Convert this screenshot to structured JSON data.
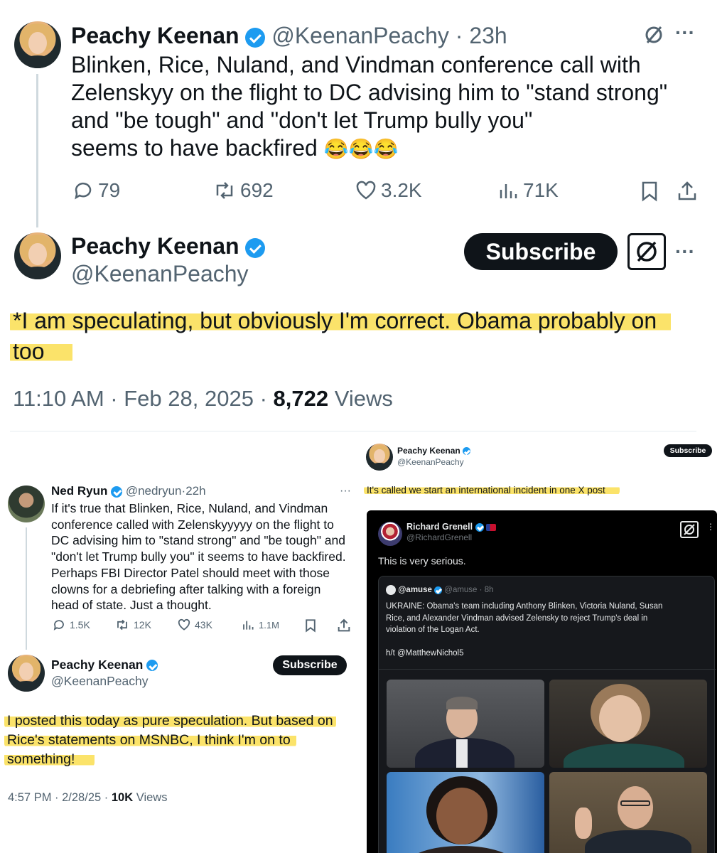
{
  "tweet1": {
    "name": "Peachy Keenan",
    "handle": "@KeenanPeachy",
    "sep": "·",
    "time": "23h",
    "text_line1": "Blinken, Rice, Nuland, and Vindman conference call with",
    "text_line2": "Zelenskyy on the flight to DC advising him to \"stand strong\"",
    "text_line3": "and \"be tough\" and \"don't let Trump bully you\"",
    "text_line4": "seems to have backfired",
    "emoji": "😂😂😂",
    "replies": "79",
    "reposts": "692",
    "likes": "3.2K",
    "views": "71K"
  },
  "tweet2": {
    "name": "Peachy Keenan",
    "handle": "@KeenanPeachy",
    "subscribe": "Subscribe",
    "text_line1": "*I am speculating, but obviously I'm correct. Obama probably on",
    "text_line2": "too",
    "time": "11:10 AM",
    "date": "Feb 28, 2025",
    "views_count": "8,722",
    "views_label": "Views"
  },
  "ned": {
    "name": "Ned Ryun",
    "handle": "@nedryun",
    "time": "22h",
    "lines": [
      "If it's true that Blinken, Rice, Nuland, and Vindman",
      "conference called with Zelenskyyyyy on the flight to",
      "DC advising him to \"stand strong\" and \"be tough\" and",
      "\"don't let Trump bully you\" it seems to have backfired.",
      "Perhaps FBI Director Patel should meet with those",
      "clowns for a debriefing after talking with a foreign",
      "head of state. Just a thought."
    ],
    "replies": "1.5K",
    "reposts": "12K",
    "likes": "43K",
    "views": "1.1M"
  },
  "tweet3": {
    "name": "Peachy Keenan",
    "handle": "@KeenanPeachy",
    "subscribe": "Subscribe",
    "line1": "I posted this today as pure speculation. But based on",
    "line2": "Rice's statements on MSNBC, I think I'm on to",
    "line3": "something!",
    "time": "4:57 PM",
    "date": "2/28/25",
    "views_count": "10K",
    "views_label": "Views"
  },
  "tweet4": {
    "name": "Peachy Keenan",
    "handle": "@KeenanPeachy",
    "subscribe": "Subscribe",
    "text": "It's called we start an international incident in one X post"
  },
  "grenell": {
    "name": "Richard Grenell",
    "handle": "@RichardGrenell",
    "text": "This is very serious.",
    "quote": {
      "name": "@amuse",
      "handle": "@amuse",
      "time": "8h",
      "line1": "UKRAINE: Obama's team including Anthony Blinken, Victoria Nuland, Susan",
      "line2": "Rice, and Alexander Vindman advised Zelensky to reject Trump's deal in",
      "line3": "violation of the Logan Act.",
      "line4": "h/t @MatthewNichol5"
    }
  },
  "colors": {
    "accent": "#1d9bf0",
    "highlight": "#fbe36a",
    "dark": "#0f1419",
    "muted": "#536471"
  }
}
